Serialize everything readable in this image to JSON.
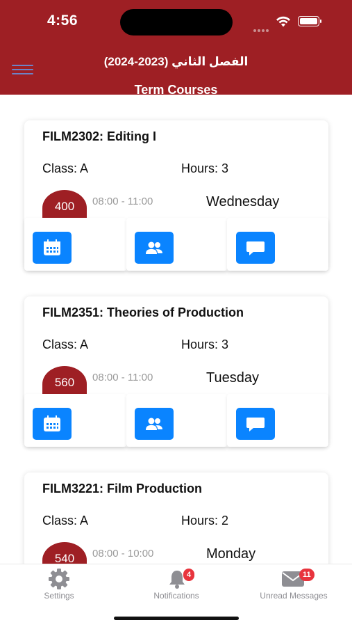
{
  "status": {
    "time": "4:56"
  },
  "header": {
    "term_title": "الفصل الثاني (2023-2024)",
    "subtitle": "Term Courses"
  },
  "colors": {
    "brand": "#9e1f24",
    "accent": "#0a84ff",
    "badge": "#e8343d"
  },
  "courses": [
    {
      "title": "FILM2302: Editing I",
      "class": "Class: A",
      "hours": "Hours: 3",
      "room": "400",
      "time": "08:00 - 11:00",
      "day": "Wednesday"
    },
    {
      "title": "FILM2351: Theories of Production",
      "class": "Class: A",
      "hours": "Hours: 3",
      "room": "560",
      "time": "08:00 - 11:00",
      "day": "Tuesday"
    },
    {
      "title": "FILM3221: Film Production",
      "class": "Class: A",
      "hours": "Hours: 2",
      "room": "540",
      "time": "08:00 - 10:00",
      "day": "Monday"
    }
  ],
  "card_actions": [
    {
      "icon": "calendar-icon"
    },
    {
      "icon": "people-icon"
    },
    {
      "icon": "chat-icon"
    }
  ],
  "tabbar": {
    "settings": {
      "label": "Settings",
      "icon": "gear-icon"
    },
    "notifications": {
      "label": "Notifications",
      "icon": "bell-icon",
      "badge": "4"
    },
    "messages": {
      "label": "Unread Messages",
      "icon": "envelope-icon",
      "badge": "11"
    }
  }
}
